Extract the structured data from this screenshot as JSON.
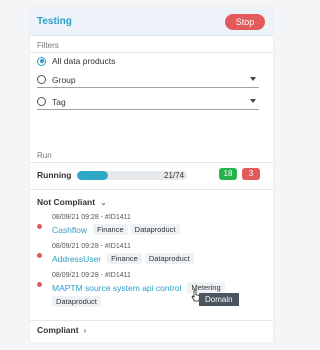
{
  "header": {
    "title": "Testing",
    "stop_label": "Stop"
  },
  "filters": {
    "label": "Filters",
    "options": [
      {
        "label": "All data products",
        "selected": true
      },
      {
        "label": "Group",
        "selected": false
      },
      {
        "label": "Tag",
        "selected": false
      }
    ]
  },
  "run": {
    "label": "Run",
    "status": "Running",
    "progress_text": "21/74",
    "progress_fraction": 0.284,
    "passed_count": "18",
    "failed_count": "3"
  },
  "not_compliant": {
    "label": "Not Compliant",
    "items": [
      {
        "meta": "08/09/21 09:28 - #ID1411",
        "name": "Cashflow",
        "tags": [
          "Finance",
          "Dataproduct"
        ]
      },
      {
        "meta": "08/09/21 09:28 - #ID1411",
        "name": "AddressUser",
        "tags": [
          "Finance",
          "Dataproduct"
        ]
      },
      {
        "meta": "08/09/21 09:28 - #ID1411",
        "name": "MAPTM source system api control",
        "tags": [
          "Metering",
          "Dataproduct"
        ]
      }
    ]
  },
  "compliant": {
    "label": "Compliant"
  },
  "tooltip": {
    "text": "Domain"
  },
  "colors": {
    "accent": "#2f9ec6",
    "danger": "#e25a5a",
    "success": "#27b24a"
  }
}
